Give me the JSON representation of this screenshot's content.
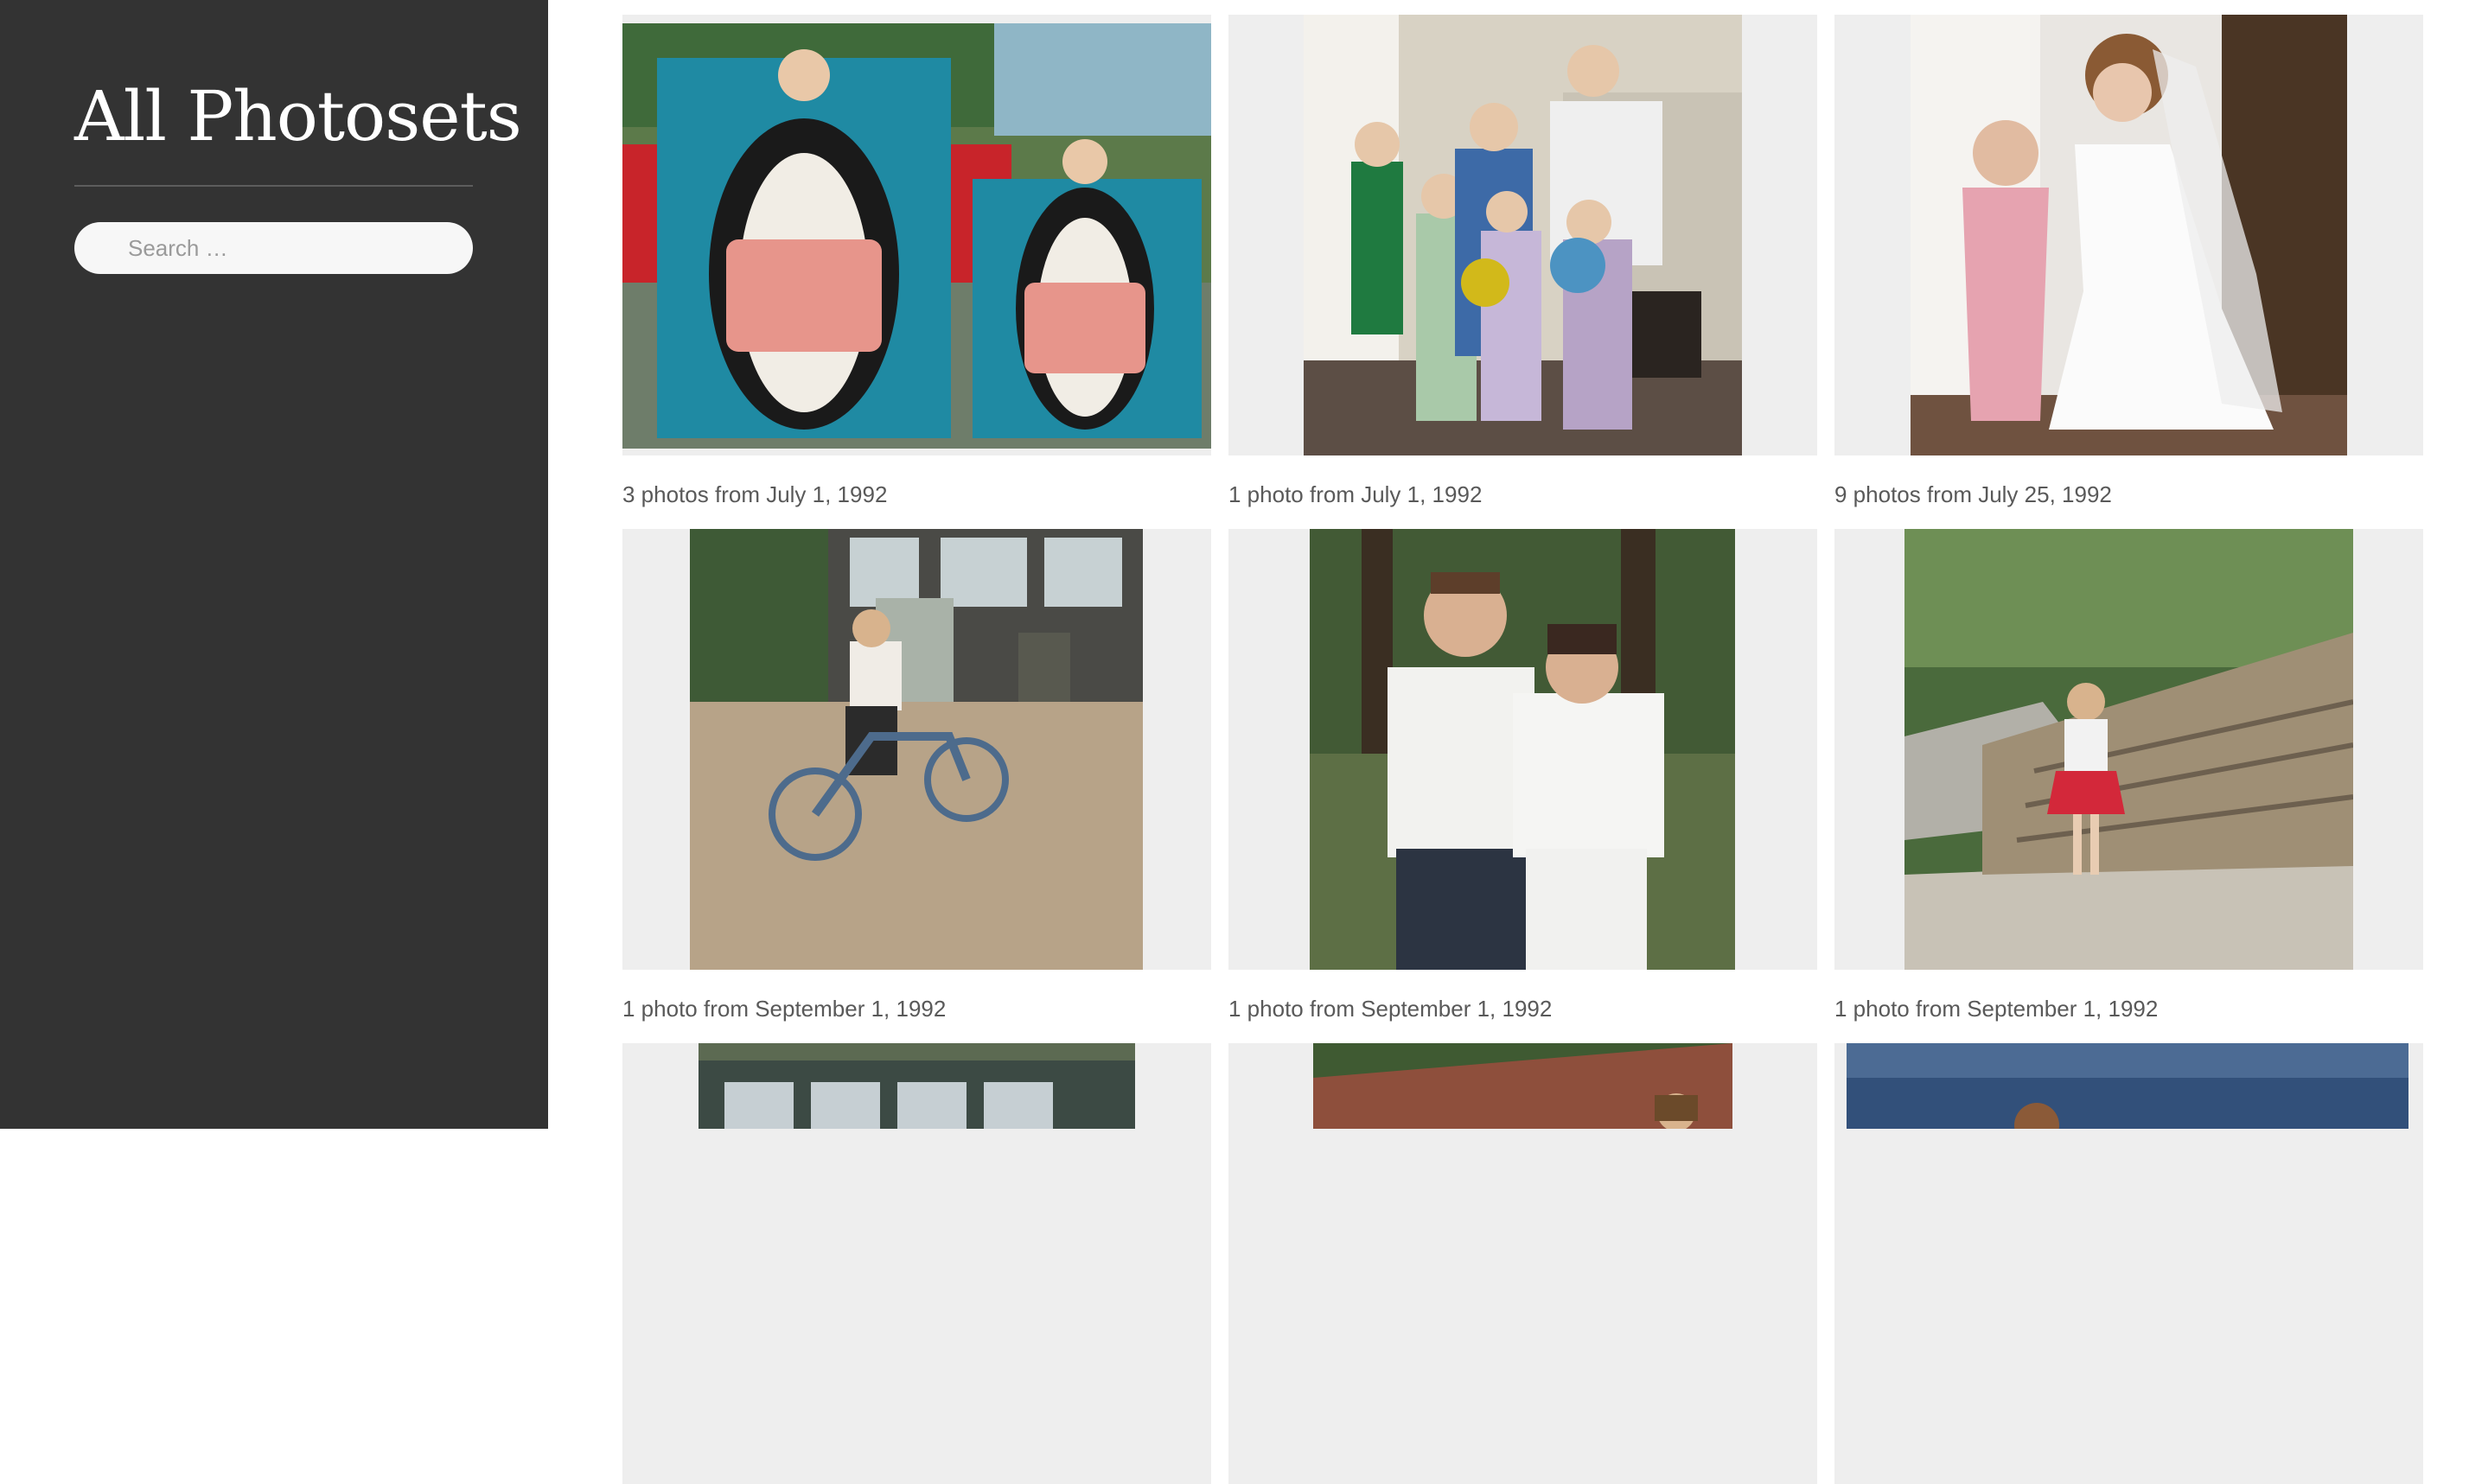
{
  "sidebar": {
    "title": "All Photosets",
    "search": {
      "placeholder": "Search …",
      "value": ""
    }
  },
  "photosets": [
    {
      "caption": "3 photos from July 1, 1992"
    },
    {
      "caption": "1 photo from July 1, 1992"
    },
    {
      "caption": "9 photos from July 25, 1992"
    },
    {
      "caption": "1 photo from September 1, 1992"
    },
    {
      "caption": "1 photo from September 1, 1992"
    },
    {
      "caption": "1 photo from September 1, 1992"
    },
    {
      "caption": ""
    },
    {
      "caption": ""
    },
    {
      "caption": ""
    }
  ]
}
